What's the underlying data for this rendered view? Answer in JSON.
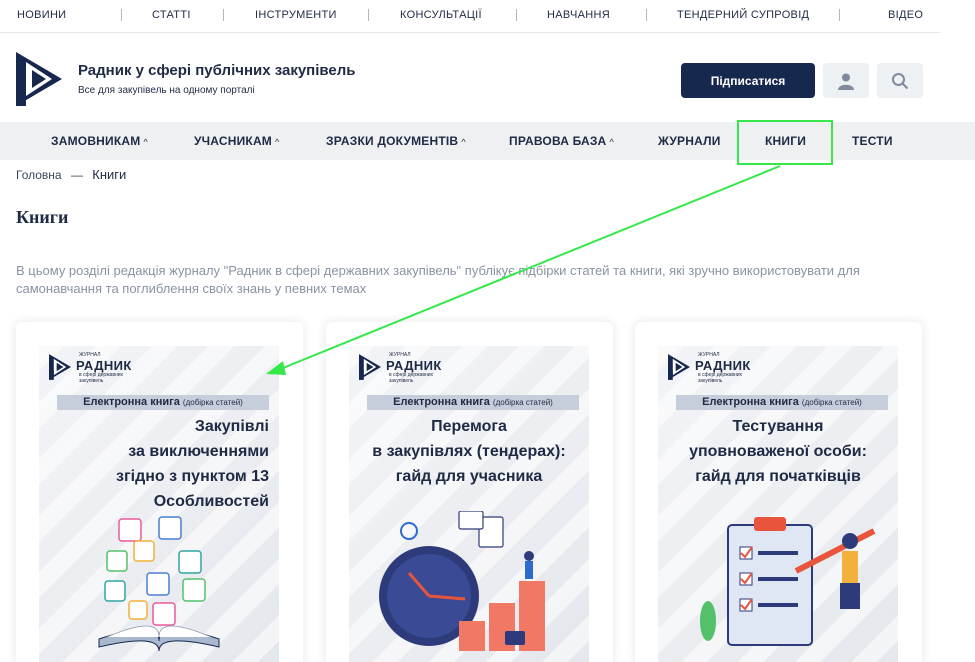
{
  "top_nav": [
    "НОВИНИ",
    "СТАТТІ",
    "ІНСТРУМЕНТИ",
    "КОНСУЛЬТАЦІЇ",
    "НАВЧАННЯ",
    "ТЕНДЕРНИЙ СУПРОВІД",
    "ВІДЕО"
  ],
  "header": {
    "title": "Радник у сфері публічних закупівель",
    "subtitle": "Все для закупівель на одному порталі",
    "subscribe_label": "Підписатися",
    "user_icon": "user-icon",
    "search_icon": "search-icon"
  },
  "main_nav": [
    {
      "label": "ЗАМОВНИКАМ",
      "has_dropdown": true
    },
    {
      "label": "УЧАСНИКАМ",
      "has_dropdown": true
    },
    {
      "label": "ЗРАЗКИ ДОКУМЕНТІВ",
      "has_dropdown": true
    },
    {
      "label": "ПРАВОВА БАЗА",
      "has_dropdown": true
    },
    {
      "label": "ЖУРНАЛИ",
      "has_dropdown": false
    },
    {
      "label": "КНИГИ",
      "has_dropdown": false,
      "highlighted": true
    },
    {
      "label": "ТЕСТИ",
      "has_dropdown": false
    }
  ],
  "breadcrumb": {
    "home": "Головна",
    "separator": "—",
    "current": "Книги"
  },
  "page_title": "Книги",
  "intro": "В цьому розділі редакція журналу \"Радник в сфері державних закупівель\" публікує підбірки статей та книги, які зручно використовувати для самонавчання та поглиблення своїх знань у певних темах",
  "books": [
    {
      "brand_top": "ЖУРНАЛ",
      "brand": "РАДНИК",
      "brand_sub": "в сфері державних закупівель",
      "label": "Електронна книга",
      "label_note": "(добірка статей)",
      "title_lines": [
        "Закупівлі",
        "за виключеннями",
        "згідно з пунктом 13",
        "Особливостей"
      ]
    },
    {
      "brand_top": "ЖУРНАЛ",
      "brand": "РАДНИК",
      "brand_sub": "в сфері державних закупівель",
      "label": "Електронна книга",
      "label_note": "(добірка статей)",
      "title_lines": [
        "Перемога",
        "в закупівлях (тендерах):",
        "гайд для учасника"
      ]
    },
    {
      "brand_top": "ЖУРНАЛ",
      "brand": "РАДНИК",
      "brand_sub": "в сфері державних закупівель",
      "label": "Електронна книга",
      "label_note": "(добірка статей)",
      "title_lines": [
        "Тестування",
        "уповноваженої особи:",
        "гайд для початківців"
      ]
    }
  ],
  "colors": {
    "brand_navy": "#17284e",
    "text": "#1f2a44",
    "muted": "#8a93a3",
    "highlight": "#35e84a",
    "nav_bg": "#eef0f2"
  }
}
